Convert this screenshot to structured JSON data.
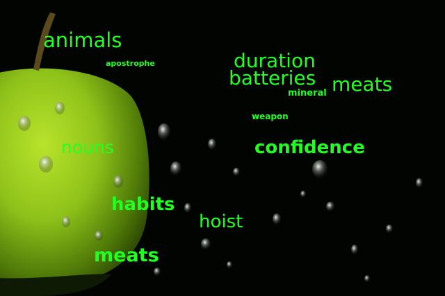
{
  "scene": {
    "subject": "green-apple-with-water-droplets",
    "background_color": "#020402",
    "apple_color": "#8ec21a",
    "text_color": "#22ff22"
  },
  "words": {
    "animals": "animals",
    "apostrophe": "apostrophe",
    "duration": "duration",
    "batteries": "batteries",
    "mineral": "mineral",
    "meats_top": "meats",
    "weapon": "weapon",
    "nouns": "nouns",
    "confidence": "confidence",
    "habits": "habits",
    "hoist": "hoist",
    "meats_bottom": "meats"
  }
}
